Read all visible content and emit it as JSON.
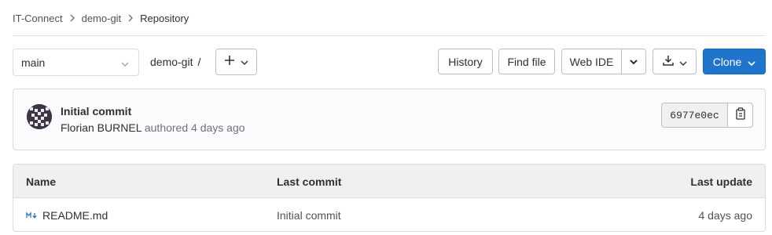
{
  "breadcrumb": {
    "items": [
      "IT-Connect",
      "demo-git",
      "Repository"
    ]
  },
  "toolbar": {
    "branch": "main",
    "path": "demo-git",
    "path_sep": "/",
    "history_label": "History",
    "find_file_label": "Find file",
    "web_ide_label": "Web IDE",
    "clone_label": "Clone"
  },
  "commit": {
    "title": "Initial commit",
    "author": "Florian BURNEL",
    "action": "authored",
    "time": "4 days ago",
    "sha": "6977e0ec"
  },
  "files": {
    "headers": {
      "name": "Name",
      "last_commit": "Last commit",
      "last_update": "Last update"
    },
    "rows": [
      {
        "name": "README.md",
        "last_commit": "Initial commit",
        "last_update": "4 days ago",
        "icon": "markdown-icon"
      }
    ]
  },
  "colors": {
    "primary": "#1f75cb",
    "border": "#dcdcde",
    "header_bg": "#f0f0f0"
  }
}
